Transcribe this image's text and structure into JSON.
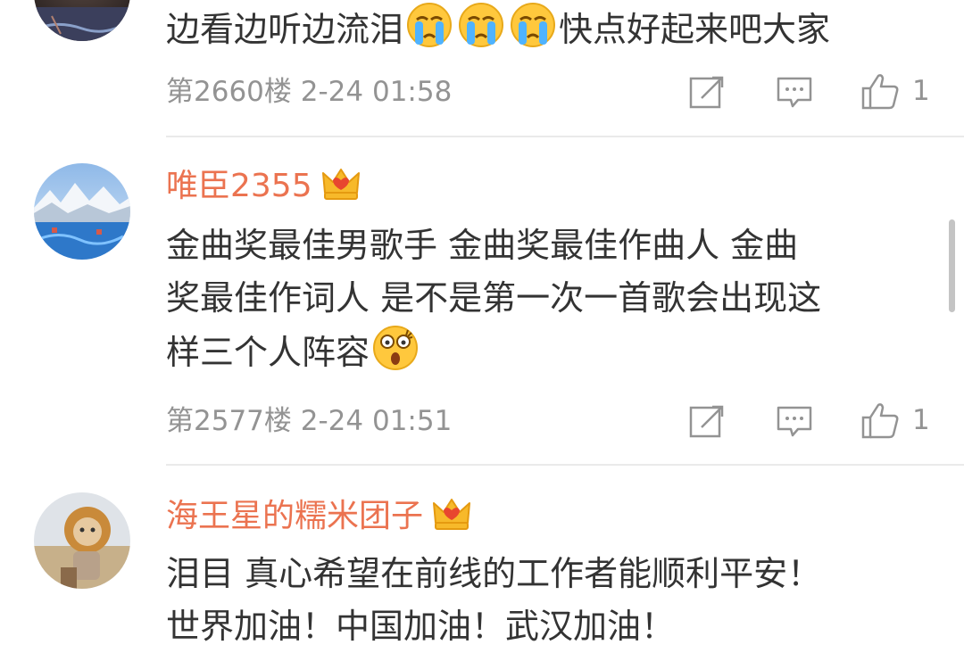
{
  "comments": [
    {
      "username": "",
      "text_parts": [
        "边看边听边流泪",
        "快点好起来吧大家"
      ],
      "emoji_icons": [
        "crying-emoji-icon",
        "crying-emoji-icon",
        "crying-emoji-icon"
      ],
      "floor": "第2660楼",
      "time": "2-24 01:58",
      "likes": "1"
    },
    {
      "username": "唯臣2355",
      "badge_icon": "crown-icon",
      "text_lines": [
        "金曲奖最佳男歌手 金曲奖最佳作曲人 金曲",
        "奖最佳作词人 是不是第一次一首歌会出现这",
        "样三个人阵容"
      ],
      "emoji_icons": [
        "shocked-emoji-icon"
      ],
      "floor": "第2577楼",
      "time": "2-24 01:51",
      "likes": "1"
    },
    {
      "username": "海王星的糯米团子",
      "badge_icon": "crown-icon",
      "text_lines": [
        "泪目 真心希望在前线的工作者能顺利平安！",
        "世界加油！中国加油！武汉加油！"
      ]
    }
  ],
  "colors": {
    "username": "#eb7350",
    "body_text": "#333333",
    "meta_text": "#939393",
    "divider": "#eaeaea"
  }
}
